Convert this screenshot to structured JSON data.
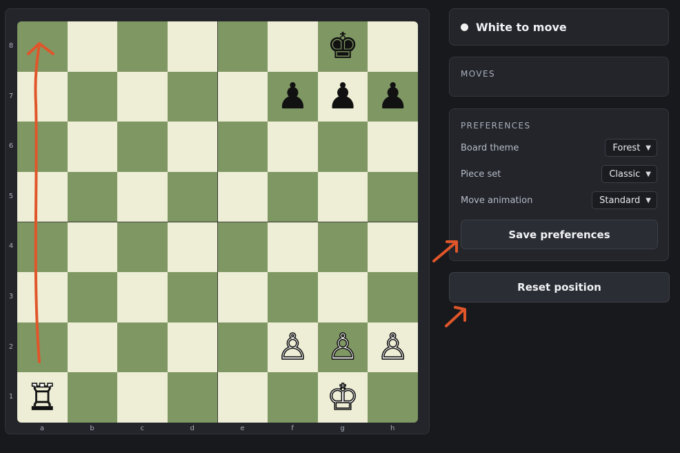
{
  "board": {
    "ranks": [
      "8",
      "7",
      "6",
      "5",
      "4",
      "3",
      "2",
      "1"
    ],
    "files": [
      "a",
      "b",
      "c",
      "d",
      "e",
      "f",
      "g",
      "h"
    ],
    "pieces": [
      {
        "square": "g8",
        "glyph": "♚",
        "color": "black",
        "name": "black-king"
      },
      {
        "square": "f7",
        "glyph": "♟",
        "color": "black",
        "name": "black-pawn"
      },
      {
        "square": "g7",
        "glyph": "♟",
        "color": "black",
        "name": "black-pawn"
      },
      {
        "square": "h7",
        "glyph": "♟",
        "color": "black",
        "name": "black-pawn"
      },
      {
        "square": "f2",
        "glyph": "♙",
        "color": "white",
        "name": "white-pawn"
      },
      {
        "square": "g2",
        "glyph": "♙",
        "color": "white",
        "name": "white-pawn"
      },
      {
        "square": "h2",
        "glyph": "♙",
        "color": "white",
        "name": "white-pawn"
      },
      {
        "square": "a1",
        "glyph": "♖",
        "color": "white",
        "name": "white-rook"
      },
      {
        "square": "g1",
        "glyph": "♔",
        "color": "white",
        "name": "white-king"
      }
    ],
    "colors": {
      "light": "#eeeed6",
      "dark": "#7f9763",
      "arrow": "#e0562a"
    }
  },
  "status": {
    "text": "White to move"
  },
  "moves": {
    "title": "MOVES"
  },
  "preferences": {
    "title": "PREFERENCES",
    "rows": [
      {
        "label": "Board theme",
        "value": "Forest"
      },
      {
        "label": "Piece set",
        "value": "Classic"
      },
      {
        "label": "Move animation",
        "value": "Standard"
      }
    ],
    "save_label": "Save preferences"
  },
  "reset_label": "Reset position"
}
